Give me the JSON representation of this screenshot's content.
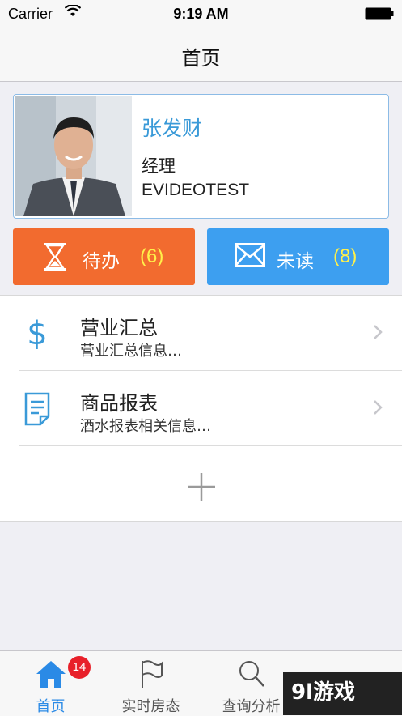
{
  "status_bar": {
    "carrier": "Carrier",
    "time": "9:19 AM"
  },
  "nav": {
    "title": "首页"
  },
  "profile": {
    "name": "张发财",
    "role": "经理",
    "company": "EVIDEOTEST"
  },
  "actions": {
    "todo": {
      "label": "待办",
      "count": "(6)",
      "color": "#f26b2f"
    },
    "unread": {
      "label": "未读",
      "count": "(8)",
      "color": "#3d9ff0"
    }
  },
  "list": [
    {
      "title": "营业汇总",
      "subtitle": "营业汇总信息…",
      "icon": "dollar-icon"
    },
    {
      "title": "商品报表",
      "subtitle": "酒水报表相关信息…",
      "icon": "document-icon"
    }
  ],
  "tabs": [
    {
      "label": "首页",
      "icon": "home-icon",
      "badge": "14",
      "active": true
    },
    {
      "label": "实时房态",
      "icon": "flag-icon"
    },
    {
      "label": "查询分析",
      "icon": "search-icon"
    }
  ],
  "watermark": {
    "text": "9l游戏"
  },
  "colors": {
    "accent": "#2a8ae6",
    "badge": "#e8202a",
    "count": "#fff04a"
  }
}
